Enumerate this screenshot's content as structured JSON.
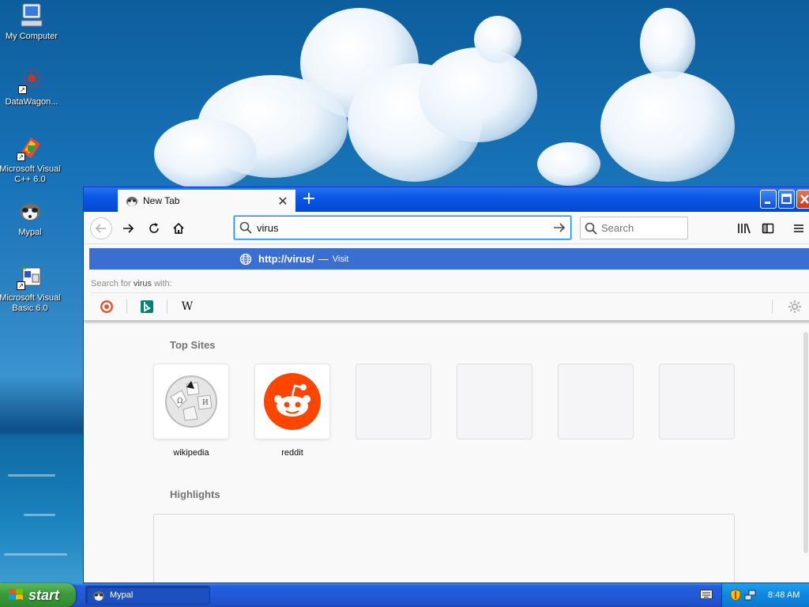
{
  "desktop": {
    "icons": [
      {
        "label": "My Computer"
      },
      {
        "label": "DataWagon..."
      },
      {
        "label_line1": "Microsoft Visual",
        "label_line2": "C++ 6.0"
      },
      {
        "label": "Mypal"
      },
      {
        "label_line1": "Microsoft Visual",
        "label_line2": "Basic 6.0"
      }
    ]
  },
  "browser": {
    "tab": {
      "title": "New Tab",
      "close": "✕",
      "icon": "mypal-raccoon-icon"
    },
    "new_tab": "+",
    "urlbar": {
      "value": "virus"
    },
    "searchbar": {
      "placeholder": "Search"
    },
    "popup": {
      "suggestion_url": "http://virus/",
      "suggestion_sep": "—",
      "suggestion_action": "Visit",
      "search_for_prefix": "Search for",
      "search_for_term": "virus",
      "search_for_suffix": "with:",
      "engines": [
        "duckduckgo-icon",
        "bing-icon",
        "wikipedia-icon"
      ],
      "wiki_glyph": "W"
    },
    "content": {
      "top_sites_title": "Top Sites",
      "top_sites": [
        {
          "label": "wikipedia"
        },
        {
          "label": "reddit"
        },
        {
          "label": ""
        },
        {
          "label": ""
        },
        {
          "label": ""
        },
        {
          "label": ""
        }
      ],
      "highlights_title": "Highlights"
    },
    "colors": {
      "accent": "#0a84ff",
      "suggest_bg": "#3a6fd1",
      "titlebar": "#0a57e6",
      "reddit": "#ff4500"
    }
  },
  "taskbar": {
    "start": "start",
    "task_label": "Mypal",
    "clock": "8:48 AM"
  }
}
